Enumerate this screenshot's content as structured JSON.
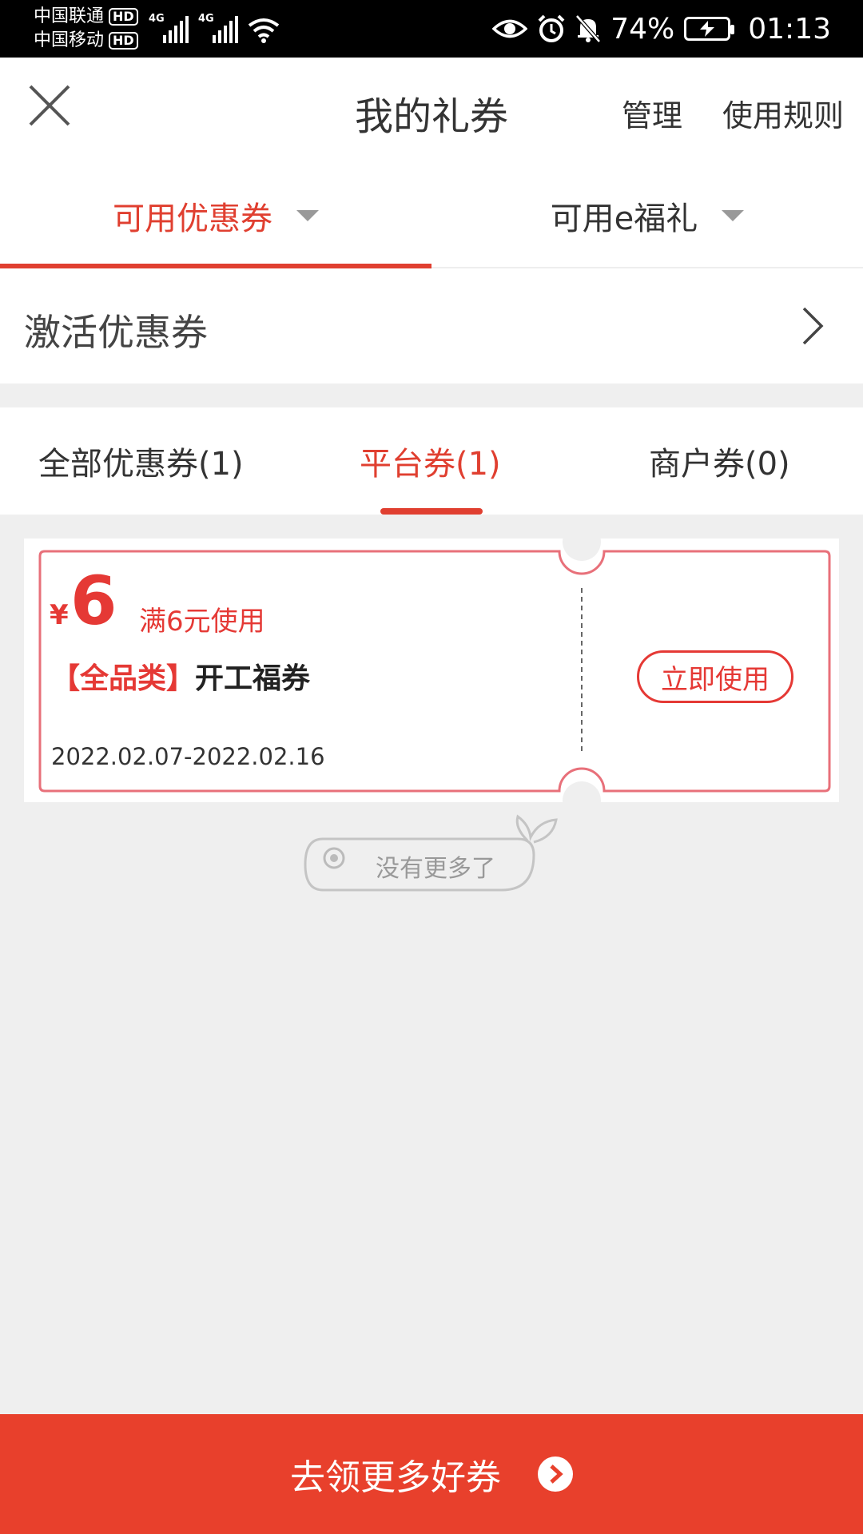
{
  "status_bar": {
    "carrier_1": "中国联通",
    "carrier_2": "中国移动",
    "hd_badge": "HD",
    "network_1": "4G",
    "network_2": "4G",
    "battery_percent": "74%",
    "time": "01:13",
    "icons": [
      "eye-icon",
      "alarm-icon",
      "mute-bell-icon",
      "battery-charging-icon",
      "wifi-icon",
      "signal-icon"
    ]
  },
  "header": {
    "title": "我的礼券",
    "manage": "管理",
    "rules": "使用规则"
  },
  "top_tabs": [
    {
      "label": "可用优惠券",
      "active": true
    },
    {
      "label": "可用e福礼",
      "active": false
    }
  ],
  "activate": {
    "label": "激活优惠券"
  },
  "sub_tabs": [
    {
      "label": "全部优惠券(1)",
      "active": false
    },
    {
      "label": "平台券(1)",
      "active": true
    },
    {
      "label": "商户券(0)",
      "active": false
    }
  ],
  "coupon": {
    "currency": "¥",
    "amount": "6",
    "condition": "满6元使用",
    "category": "【全品类】",
    "name": "开工福券",
    "validity": "2022.02.07-2022.02.16",
    "use_button": "立即使用"
  },
  "no_more": "没有更多了",
  "bottom_button": "去领更多好券",
  "colors": {
    "accent": "#e03f30",
    "bottom_bar": "#e8402c",
    "background": "#efefef"
  }
}
